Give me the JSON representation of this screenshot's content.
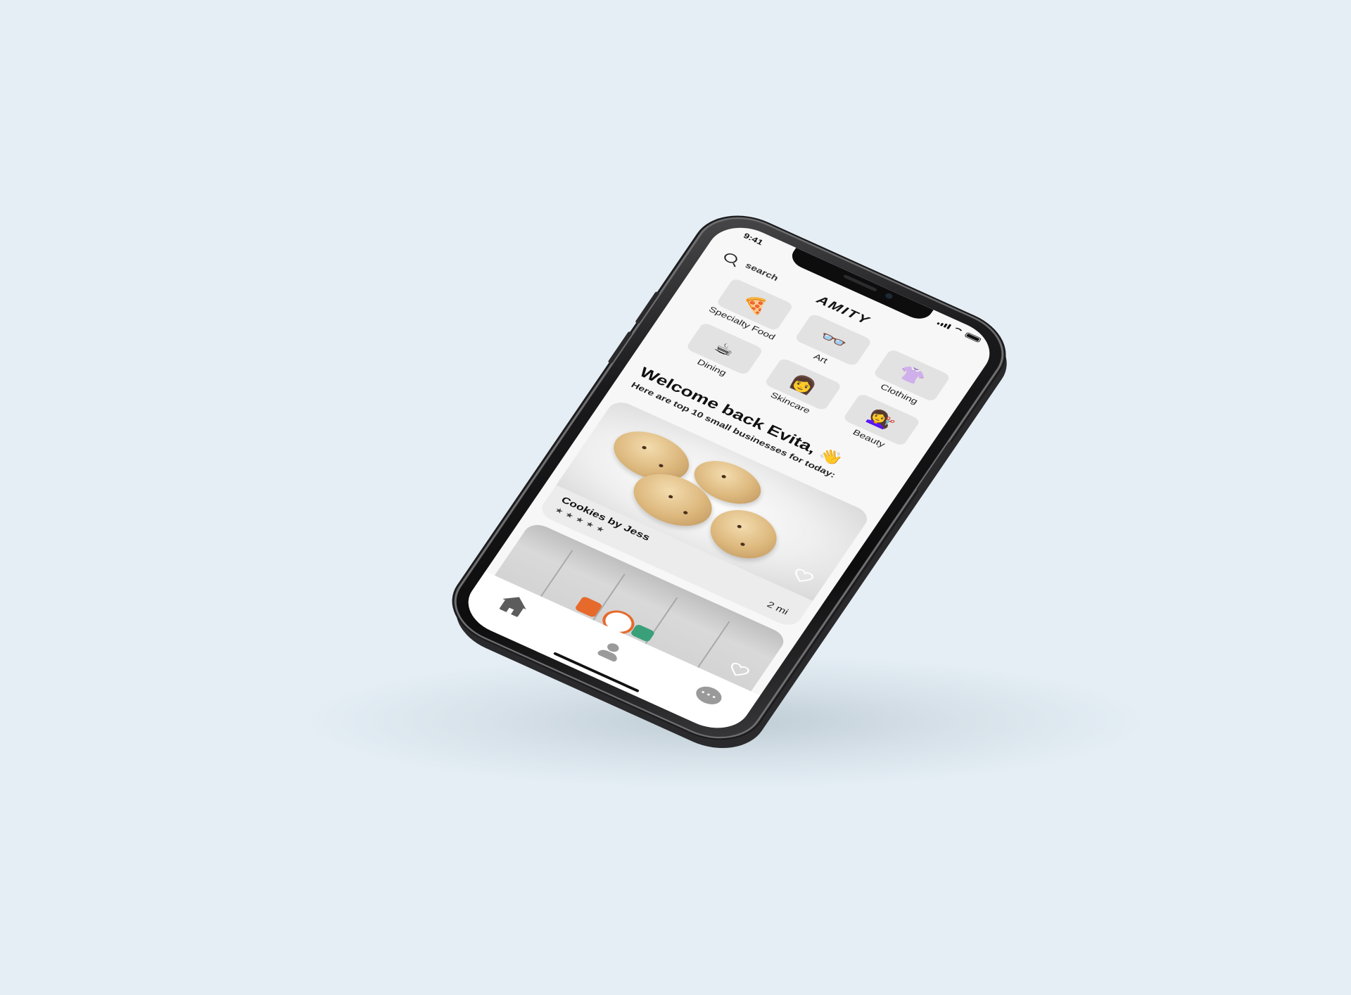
{
  "status_bar": {
    "time": "9:41"
  },
  "header": {
    "search_placeholder": "search",
    "brand": "AMITY"
  },
  "categories": [
    {
      "label": "Specialty Food",
      "emoji": "🍕",
      "icon": "pizza-icon"
    },
    {
      "label": "Art",
      "emoji": "👓",
      "icon": "glasses-icon"
    },
    {
      "label": "Clothing",
      "emoji": "👚",
      "icon": "shirt-icon"
    },
    {
      "label": "Dining",
      "emoji": "☕",
      "icon": "coffee-icon"
    },
    {
      "label": "Skincare",
      "emoji": "👩",
      "icon": "woman-icon"
    },
    {
      "label": "Beauty",
      "emoji": "💇‍♀️",
      "icon": "haircut-icon"
    }
  ],
  "welcome": {
    "title": "Welcome back Evita,",
    "wave_emoji": "👋",
    "subtitle": "Here are top 10 small businesses for today:"
  },
  "featured": [
    {
      "name": "Cookies by Jess",
      "stars": "★★★★★",
      "distance": "2 mi",
      "favorite": false
    },
    {
      "name": "",
      "favorite": false
    }
  ],
  "tabbar": {
    "tabs": [
      {
        "icon": "home-icon",
        "active": true
      },
      {
        "icon": "person-icon",
        "active": false
      },
      {
        "icon": "chat-icon",
        "active": false
      }
    ]
  },
  "colors": {
    "background": "#e5eef5",
    "screen": "#f7f7f7",
    "tile": "#e2e2e2",
    "icon_active": "#5c5c5c",
    "icon_inactive": "#9a9a9a"
  }
}
